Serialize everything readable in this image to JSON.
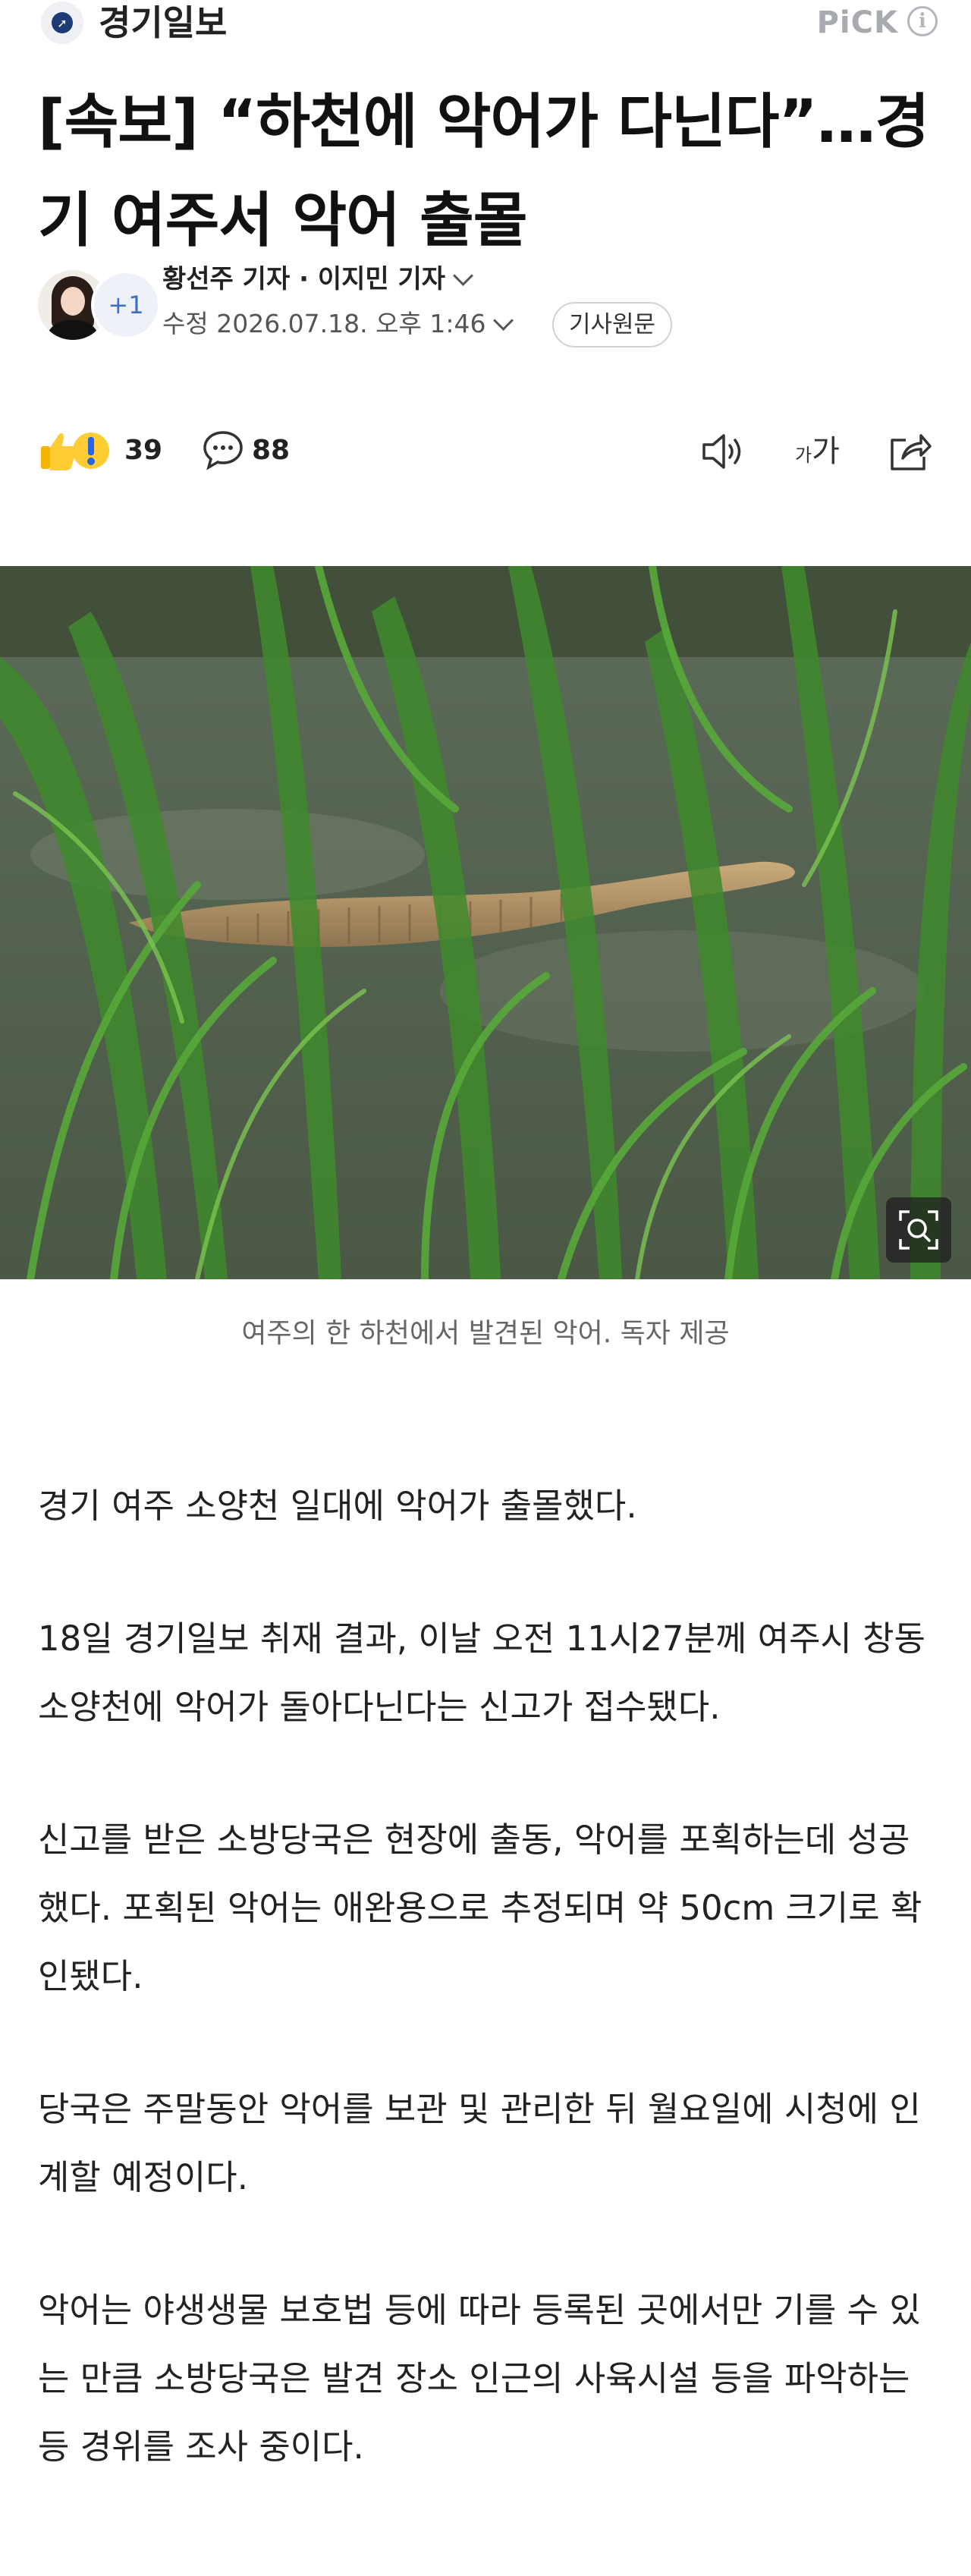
{
  "header": {
    "press_name": "경기일보",
    "pick_label": "PiCK",
    "info_icon": "info-icon",
    "info_glyph": "i"
  },
  "article": {
    "headline": "[속보] “하천에 악어가 다닌다”…경기 여주서 악어 출몰",
    "byline": {
      "reporters": "황선주 기자 · 이지민 기자",
      "extra_reporters": "+1",
      "datetime": "수정 2026.07.18. 오후 1:46",
      "original_button": "기사원문"
    },
    "actions": {
      "reaction_count": "39",
      "comment_count": "88",
      "fontsize_small": "가",
      "fontsize_big": "가"
    },
    "photo": {
      "caption": "여주의 한 하천에서 발견된 악어. 독자 제공"
    },
    "paragraphs": [
      "경기 여주 소양천 일대에 악어가 출몰했다.",
      "18일 경기일보 취재 결과, 이날 오전 11시27분께 여주시 창동 소양천에 악어가 돌아다닌다는 신고가 접수됐다.",
      "신고를 받은 소방당국은 현장에 출동, 악어를 포획하는데 성공했다. 포획된 악어는 애완용으로 추정되며 약 50cm 크기로 확인됐다.",
      "당국은 주말동안 악어를 보관 및 관리한 뒤 월요일에 시청에 인계할 예정이다.",
      "악어는 야생생물 보호법 등에 따라 등록된 곳에서만 기를 수 있는 만큼 소방당국은 발견 장소 인근의 사육시설 등을 파악하는 등 경위를 조사 중이다."
    ]
  },
  "colors": {
    "accent_blue": "#3d6fc4",
    "text": "#222222",
    "muted": "#666666"
  }
}
